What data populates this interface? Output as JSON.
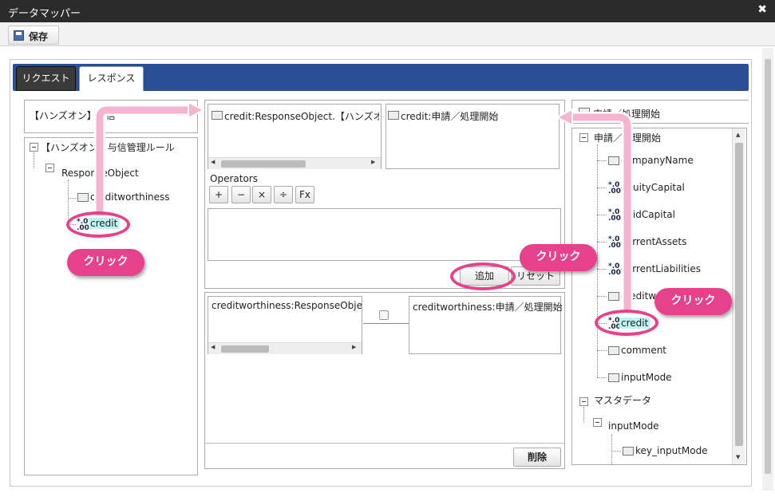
{
  "window": {
    "title": "データマッパー",
    "close_glyph": "✖"
  },
  "toolbar": {
    "save_label": "保存"
  },
  "tabs": [
    {
      "label": "リクエスト"
    },
    {
      "label": "レスポンス"
    }
  ],
  "left": {
    "search_value": "【ハンズオン】与信",
    "tree": {
      "root": "【ハンズオン】与信管理ルール",
      "child": "ResponseObject",
      "fields": [
        "creditworthiness",
        "credit"
      ]
    }
  },
  "middle": {
    "source_box": "credit:ResponseObject.【ハンズオン】与",
    "target_box": "credit:申請／処理開始",
    "operators_label": "Operators",
    "operators": [
      "+",
      "−",
      "×",
      "÷",
      "Fx"
    ],
    "add_button": "追加",
    "reset_button": "リセット",
    "mapping": {
      "source": "creditworthiness:ResponseObject.",
      "target": "creditworthiness:申請／処理開始"
    },
    "delete_button": "削除"
  },
  "right": {
    "header": "申請／処理開始",
    "tree_root": "申請／処理開始",
    "items": [
      "companyName",
      "equityCapital",
      "paidCapital",
      "currentAssets",
      "currentLiabilities",
      "creditworthiness",
      "credit",
      "comment",
      "inputMode"
    ],
    "master_root": "マスタデータ",
    "master_child": "inputMode",
    "master_leaf": "key_inputMode"
  },
  "num_icon_top": "*.0",
  "num_icon_bottom": ".00",
  "callouts": [
    "クリック",
    "クリック",
    "クリック"
  ],
  "colors": {
    "accent": "#e6418a",
    "tabstrip": "#2a4f96",
    "highlight": "#bdf3f5"
  }
}
